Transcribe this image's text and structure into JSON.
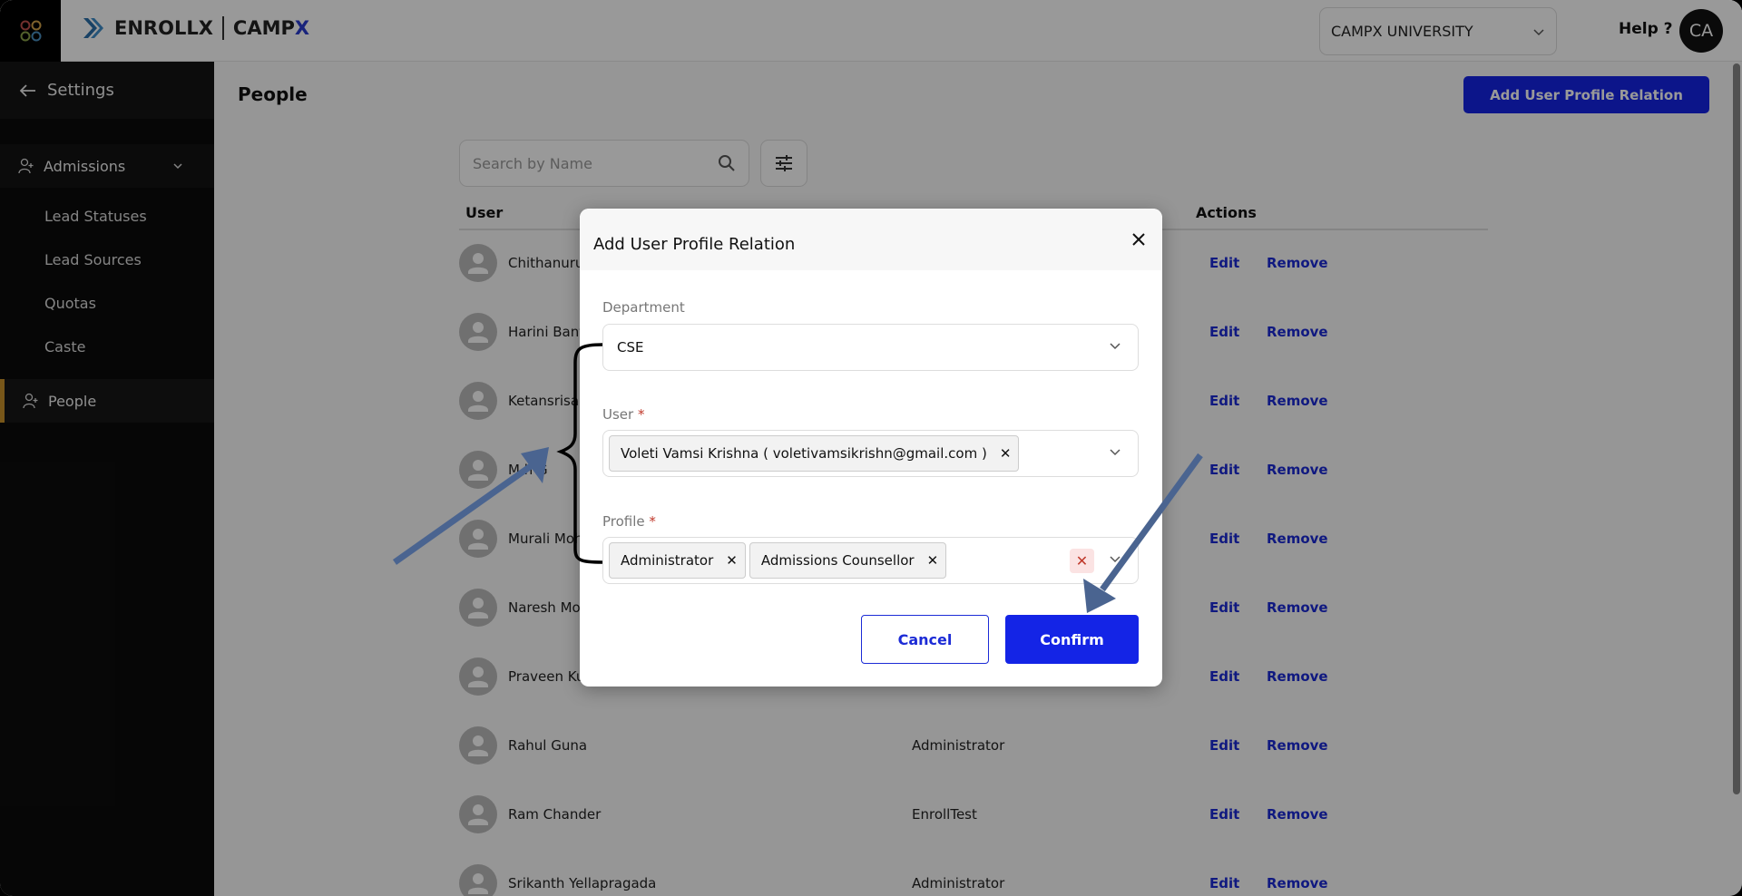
{
  "header": {
    "brand_left": "ENROLLX",
    "brand_right_a": "CAMP",
    "brand_right_b": "X",
    "institution": "CAMPX UNIVERSITY",
    "help": "Help ?",
    "avatar_initials": "CA"
  },
  "sidebar": {
    "back_label": "Settings",
    "group": "Admissions",
    "sub_items": [
      "Lead Statuses",
      "Lead Sources",
      "Quotas",
      "Caste"
    ],
    "active_item": "People"
  },
  "page": {
    "title": "People",
    "add_button": "Add User Profile Relation",
    "search_placeholder": "Search by Name"
  },
  "table": {
    "columns": {
      "user": "User",
      "actions": "Actions"
    },
    "edit_label": "Edit",
    "remove_label": "Remove",
    "rows": [
      {
        "name": "Chithanuru",
        "profile": ""
      },
      {
        "name": "Harini Bant",
        "profile": ""
      },
      {
        "name": "Ketansrisai",
        "profile": ""
      },
      {
        "name": "M h G",
        "profile": ""
      },
      {
        "name": "Murali Moh",
        "profile": ""
      },
      {
        "name": "Naresh Mo",
        "profile": ""
      },
      {
        "name": "Praveen Ku",
        "profile": ""
      },
      {
        "name": "Rahul Guna",
        "profile": "Administrator"
      },
      {
        "name": "Ram Chander",
        "profile": "EnrollTest"
      },
      {
        "name": "Srikanth Yellapragada",
        "profile": "Administrator"
      }
    ]
  },
  "modal": {
    "title": "Add User Profile Relation",
    "department": {
      "label": "Department",
      "value": "CSE"
    },
    "user": {
      "label": "User",
      "required": "*",
      "chip": "Voleti Vamsi Krishna ( voletivamsikrishn@gmail.com )"
    },
    "profile": {
      "label": "Profile",
      "required": "*",
      "chips": [
        "Administrator",
        "Admissions Counsellor"
      ]
    },
    "cancel": "Cancel",
    "confirm": "Confirm"
  },
  "colors": {
    "accent": "#1424e6",
    "sidebar_bg": "#0b0b0b",
    "active_marker": "#c8922a",
    "annotation_arrow": "#4a6490"
  }
}
